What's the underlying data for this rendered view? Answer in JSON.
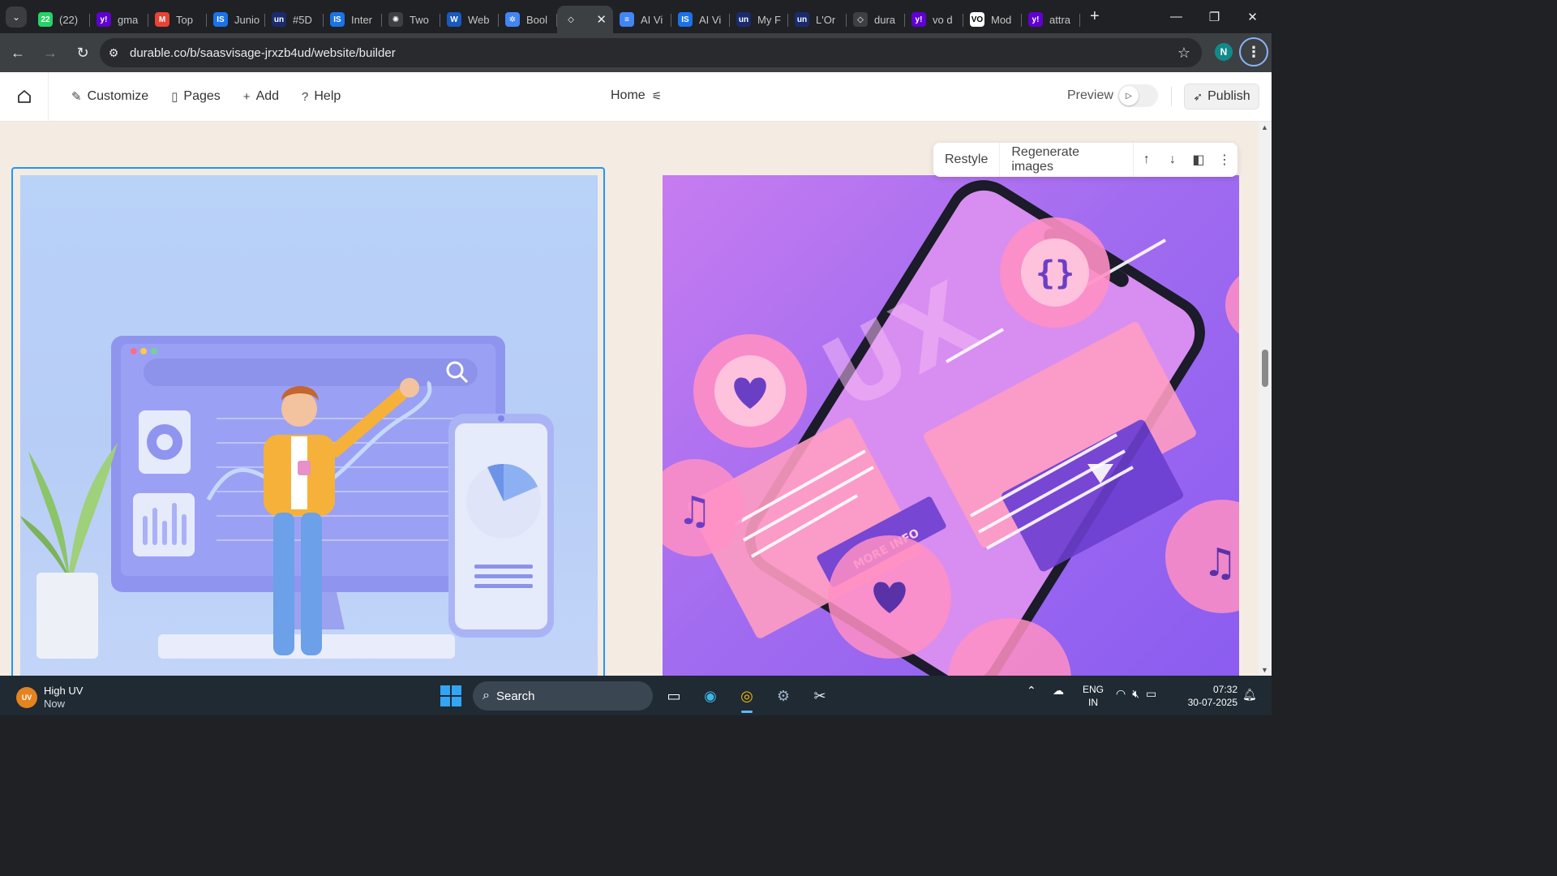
{
  "browser": {
    "tabs": [
      {
        "label": "(22)",
        "favicon": "whatsapp-icon",
        "color": "#25d366",
        "glyph": "22"
      },
      {
        "label": "gma",
        "favicon": "yahoo-icon",
        "color": "#6001d2",
        "glyph": "y!"
      },
      {
        "label": "Top",
        "favicon": "gmail-icon",
        "color": "#ea4335",
        "glyph": "M"
      },
      {
        "label": "Junio",
        "favicon": "is-icon",
        "color": "#1a73e8",
        "glyph": "IS"
      },
      {
        "label": "#5D",
        "favicon": "upwork-icon",
        "color": "#1a2b6d",
        "glyph": "un"
      },
      {
        "label": "Inter",
        "favicon": "is-icon",
        "color": "#1a73e8",
        "glyph": "IS"
      },
      {
        "label": "Two",
        "favicon": "openai-icon",
        "color": "#3c4043",
        "glyph": "✺"
      },
      {
        "label": "Web",
        "favicon": "word-icon",
        "color": "#185abd",
        "glyph": "W"
      },
      {
        "label": "Bool",
        "favicon": "gear-favicon-icon",
        "color": "#4285f4",
        "glyph": "✲"
      },
      {
        "label": "",
        "favicon": "durable-icon",
        "color": "#3c4043",
        "glyph": "◇",
        "active": true
      },
      {
        "label": "AI Vi",
        "favicon": "docs-icon",
        "color": "#4285f4",
        "glyph": "≡"
      },
      {
        "label": "AI Vi",
        "favicon": "is-icon",
        "color": "#1a73e8",
        "glyph": "IS"
      },
      {
        "label": "My F",
        "favicon": "upwork-icon",
        "color": "#1a2b6d",
        "glyph": "un"
      },
      {
        "label": "L'Or",
        "favicon": "upwork-icon",
        "color": "#1a2b6d",
        "glyph": "un"
      },
      {
        "label": "dura",
        "favicon": "durable-icon",
        "color": "#3c4043",
        "glyph": "◇"
      },
      {
        "label": "vo d",
        "favicon": "yahoo-icon",
        "color": "#6001d2",
        "glyph": "y!"
      },
      {
        "label": "Mod",
        "favicon": "vo-icon",
        "color": "#ffffff",
        "glyph": "VO"
      },
      {
        "label": "attra",
        "favicon": "yahoo-icon",
        "color": "#6001d2",
        "glyph": "y!"
      }
    ],
    "url": "durable.co/b/saasvisage-jrxzb4ud/website/builder",
    "profile_initial": "N"
  },
  "builder": {
    "nav": {
      "customize": "Customize",
      "pages": "Pages",
      "add": "Add",
      "help": "Help"
    },
    "page_selector": "Home",
    "preview_label": "Preview",
    "publish_label": "Publish"
  },
  "section_toolbar": {
    "restyle": "Restyle",
    "regenerate": "Regenerate images"
  },
  "taskbar": {
    "weather_title": "High UV",
    "weather_sub": "Now",
    "weather_badge": "UV",
    "search_label": "Search",
    "lang_top": "ENG",
    "lang_bottom": "IN",
    "time": "07:32",
    "date": "30-07-2025"
  },
  "colors": {
    "accent": "#2196f3",
    "canvas_bg": "#f4ece2"
  }
}
